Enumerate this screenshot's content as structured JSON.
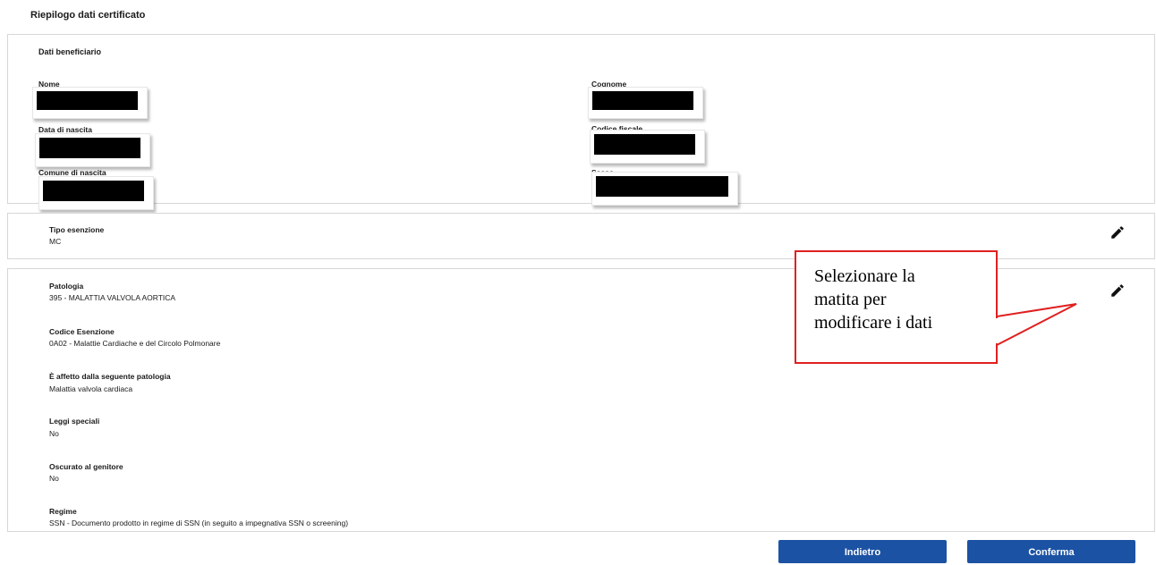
{
  "page": {
    "title": "Riepilogo dati certificato"
  },
  "beneficiario": {
    "title": "Dati beneficiario",
    "nome_label": "Nome",
    "cognome_label": "Cognome",
    "data_nascita_label": "Data di nascita",
    "codice_fiscale_label": "Codice fiscale",
    "comune_nascita_label": "Comune di nascita",
    "sesso_label": "Sesso"
  },
  "tipo_esenzione": {
    "label": "Tipo esenzione",
    "value": "MC"
  },
  "patologia": {
    "fields": [
      {
        "label": "Patologia",
        "value": "395 - MALATTIA VALVOLA AORTICA"
      },
      {
        "label": "Codice Esenzione",
        "value": "0A02 - Malattie Cardiache e del Circolo Polmonare"
      },
      {
        "label": "È affetto dalla seguente patologia",
        "value": "Malattia valvola cardiaca"
      },
      {
        "label": "Leggi speciali",
        "value": "No"
      },
      {
        "label": "Oscurato al genitore",
        "value": "No"
      },
      {
        "label": "Regime",
        "value": "SSN - Documento prodotto in regime di SSN (in seguito a impegnativa SSN o screening)"
      }
    ]
  },
  "buttons": {
    "back": "Indietro",
    "confirm": "Conferma"
  },
  "callout": {
    "text": "Selezionare la\nmatita per\nmodificare i dati",
    "border_color": "#e02020"
  },
  "colors": {
    "primary": "#1c52a3",
    "border": "#d7d7d7"
  }
}
